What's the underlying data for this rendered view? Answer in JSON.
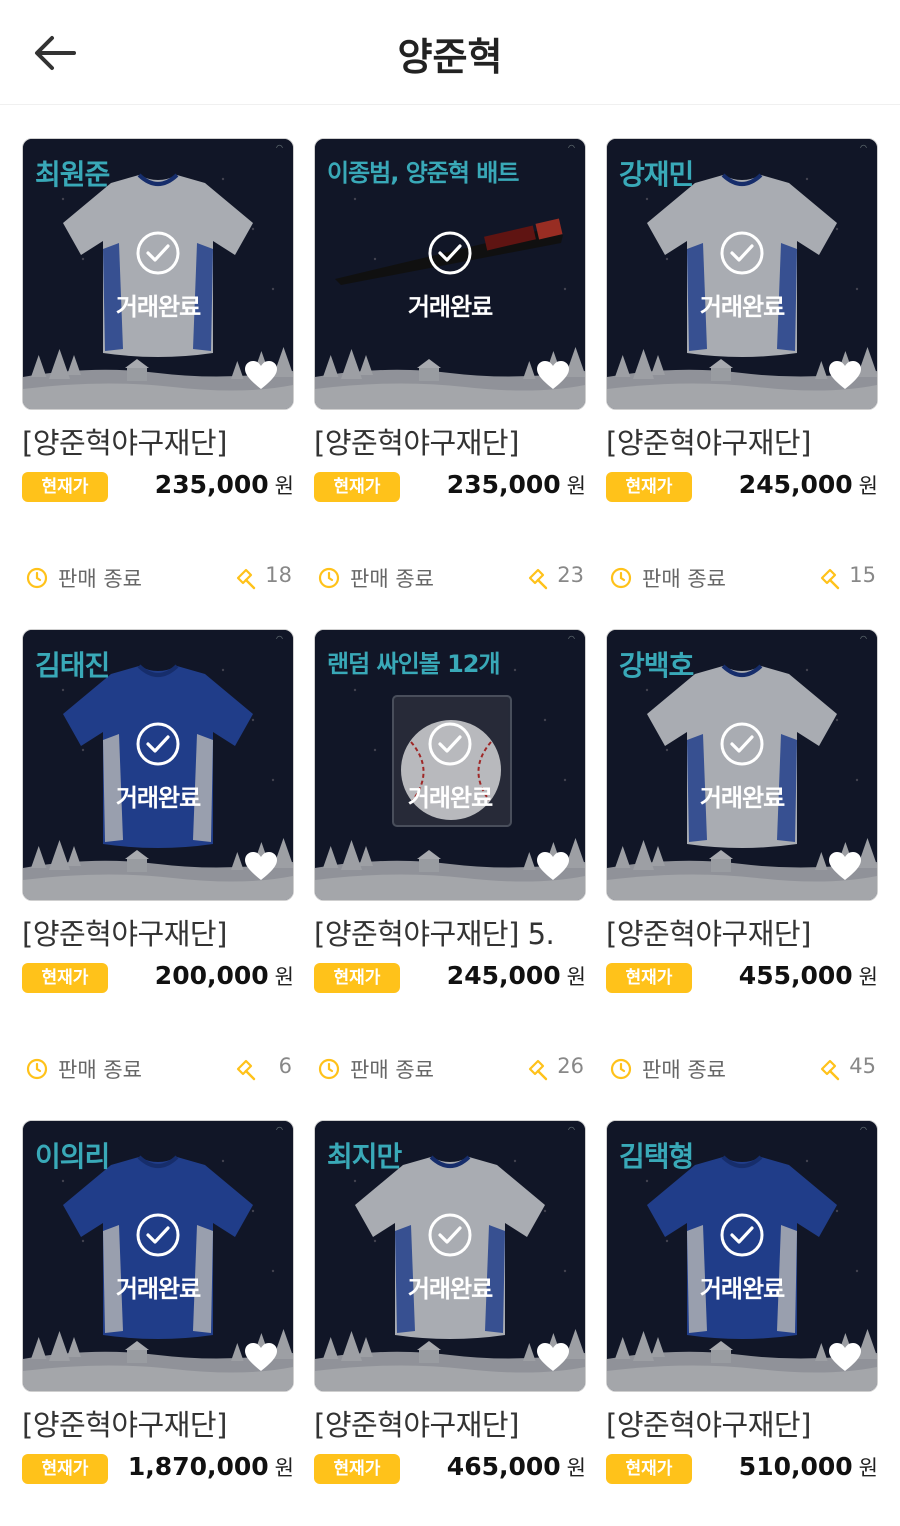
{
  "header": {
    "title": "양준혁",
    "back_label": "back"
  },
  "done_label": "거래완료",
  "badge_label": "현재가",
  "currency": "원",
  "status_label": "판매 종료",
  "colors": {
    "accent": "#ffc21a",
    "player_text": "#39a9b8",
    "card_bg": "#161d33"
  },
  "items": [
    {
      "player": "최원준",
      "item_type": "jersey-white",
      "shop": "[양준혁야구재단]",
      "price": "235,000",
      "bids": "18"
    },
    {
      "player": "이종범, 양준혁 배트",
      "item_type": "bat",
      "shop": "[양준혁야구재단]",
      "price": "235,000",
      "bids": "23"
    },
    {
      "player": "강재민",
      "item_type": "jersey-white",
      "shop": "[양준혁야구재단]",
      "price": "245,000",
      "bids": "15"
    },
    {
      "player": "김태진",
      "item_type": "jersey-blue",
      "shop": "[양준혁야구재단]",
      "price": "200,000",
      "bids": "6"
    },
    {
      "player": "랜덤 싸인볼 12개",
      "item_type": "ball",
      "shop": "[양준혁야구재단] 5.",
      "price": "245,000",
      "bids": "26"
    },
    {
      "player": "강백호",
      "item_type": "jersey-white",
      "shop": "[양준혁야구재단]",
      "price": "455,000",
      "bids": "45"
    },
    {
      "player": "이의리",
      "item_type": "jersey-blue",
      "shop": "[양준혁야구재단]",
      "price": "1,870,000",
      "bids": ""
    },
    {
      "player": "최지만",
      "item_type": "jersey-white",
      "shop": "[양준혁야구재단]",
      "price": "465,000",
      "bids": ""
    },
    {
      "player": "김택형",
      "item_type": "jersey-blue",
      "shop": "[양준혁야구재단]",
      "price": "510,000",
      "bids": ""
    }
  ]
}
